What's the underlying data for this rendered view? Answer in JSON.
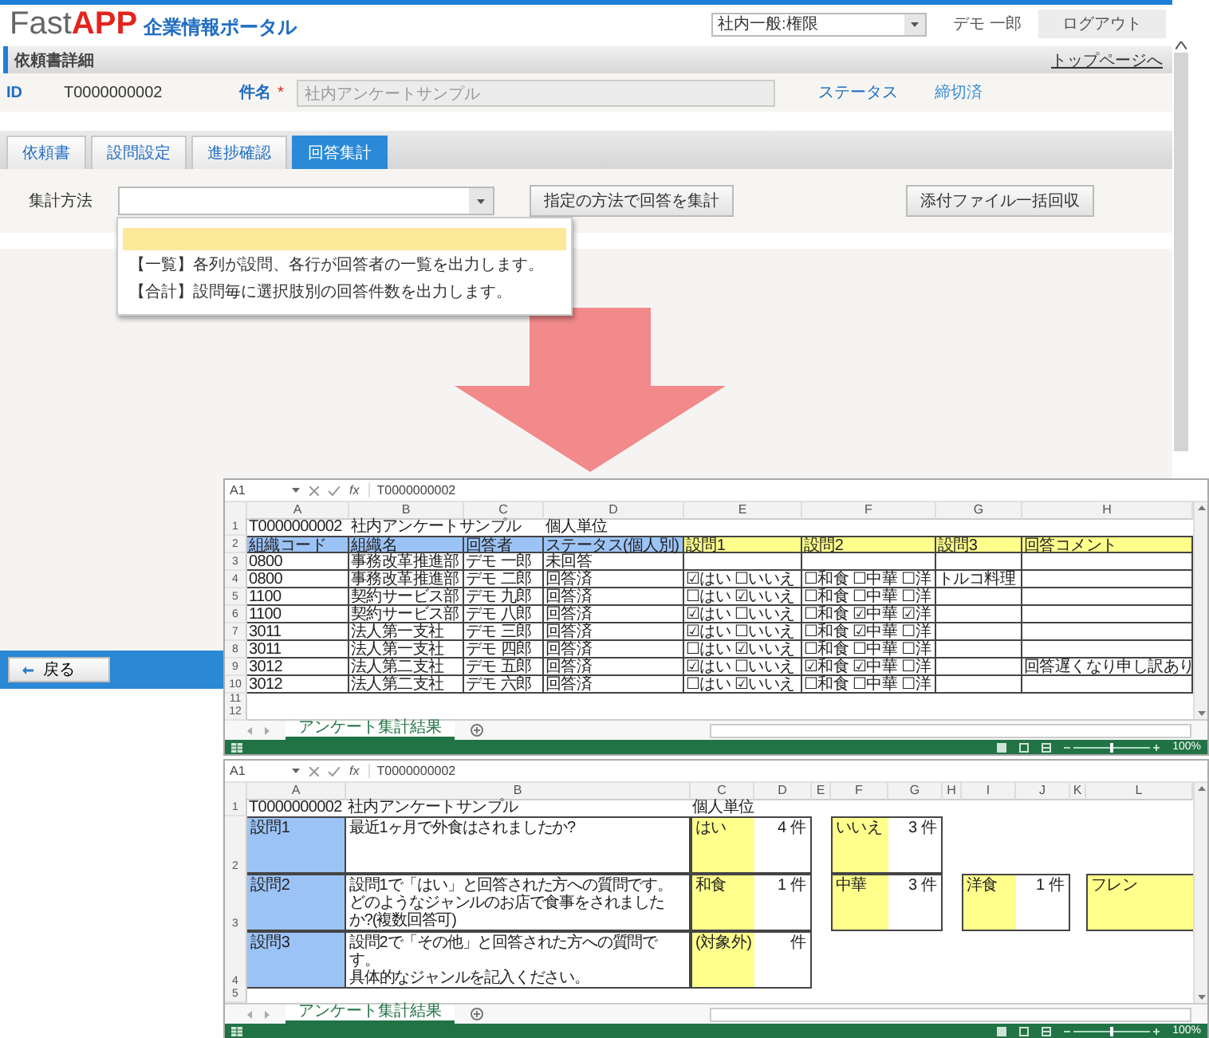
{
  "app": {
    "logo": {
      "brand_a": "Fast",
      "brand_b": "APP",
      "subtitle": "企業情報ポータル"
    },
    "role_select": {
      "value": "社内一般:権限"
    },
    "user_name": "デモ 一郎",
    "logout_button": "ログアウト",
    "section_title": "依頼書詳細",
    "top_page_link": "トップページへ",
    "id_label": "ID",
    "id_value": "T0000000002",
    "subject_label": "件名",
    "required_mark": "*",
    "subject_value": "社内アンケートサンプル",
    "status_label": "ステータス",
    "status_value": "締切済",
    "tabs": [
      {
        "label": "依頼書",
        "selected": false
      },
      {
        "label": "設問設定",
        "selected": false
      },
      {
        "label": "進捗確認",
        "selected": false
      },
      {
        "label": "回答集計",
        "selected": true
      }
    ],
    "method_label": "集計方法",
    "method_options": [
      {
        "kind": "blank",
        "selected": true
      },
      {
        "kind": "text",
        "text": "【一覧】各列が設問、各行が回答者の一覧を出力します。",
        "selected": false
      },
      {
        "kind": "text",
        "text": "【合計】設問毎に選択肢別の回答件数を出力します。",
        "selected": false
      }
    ],
    "buttons": [
      "指定の方法で回答を集計",
      "添付ファイル一括回収"
    ],
    "back_button": "戻る"
  },
  "sheets": [
    {
      "kind": "list",
      "name_box": "A1",
      "function_label": "fx",
      "formula": "T0000000002",
      "columns": [
        "A",
        "B",
        "C",
        "D",
        "E",
        "F",
        "G",
        "H"
      ],
      "rows": [
        {
          "number": "1",
          "kind": "title",
          "cells": [
            "T0000000002",
            "社内アンケートサンプル",
            null,
            "個人単位"
          ]
        },
        {
          "number": "2",
          "kind": "header",
          "cells": [
            {
              "text": "組織コード",
              "color": "#9cc3f5"
            },
            {
              "text": "組織名",
              "color": "#9cc3f5"
            },
            {
              "text": "回答者",
              "color": "#9cc3f5"
            },
            {
              "text": "ステータス(個人別)",
              "color": "#9cc3f5"
            },
            {
              "text": "設問1",
              "color": "#ffff8c"
            },
            {
              "text": "設問2",
              "color": "#ffff8c"
            },
            {
              "text": "設問3",
              "color": "#ffff8c"
            },
            {
              "text": "回答コメント",
              "color": "#ffff8c"
            }
          ]
        },
        {
          "number": "3",
          "kind": "data",
          "cells": [
            "0800",
            "事務改革推進部",
            "デモ 一郎",
            "未回答"
          ]
        },
        {
          "number": "4",
          "kind": "data",
          "cells": [
            "0800",
            "事務改革推進部",
            "デモ 二郎",
            "回答済",
            "☑はい ☐いいえ",
            "☐和食 ☐中華 ☐洋",
            "トルコ料理"
          ]
        },
        {
          "number": "5",
          "kind": "data",
          "cells": [
            "1100",
            "契約サービス部",
            "デモ 九郎",
            "回答済",
            "☐はい ☑いいえ",
            "☐和食 ☐中華 ☐洋"
          ]
        },
        {
          "number": "6",
          "kind": "data",
          "cells": [
            "1100",
            "契約サービス部",
            "デモ 八郎",
            "回答済",
            "☑はい ☐いいえ",
            "☐和食 ☑中華 ☑洋"
          ]
        },
        {
          "number": "7",
          "kind": "data",
          "cells": [
            "3011",
            "法人第一支社",
            "デモ 三郎",
            "回答済",
            "☑はい ☐いいえ",
            "☐和食 ☑中華 ☐洋"
          ]
        },
        {
          "number": "8",
          "kind": "data",
          "cells": [
            "3011",
            "法人第一支社",
            "デモ 四郎",
            "回答済",
            "☐はい ☑いいえ",
            "☐和食 ☐中華 ☐洋"
          ]
        },
        {
          "number": "9",
          "kind": "data",
          "cells": [
            "3012",
            "法人第二支社",
            "デモ 五郎",
            "回答済",
            "☑はい ☐いいえ",
            "☑和食 ☑中華 ☐洋",
            null,
            "回答遅くなり申し訳あり"
          ]
        },
        {
          "number": "10",
          "kind": "data",
          "cells": [
            "3012",
            "法人第二支社",
            "デモ 六郎",
            "回答済",
            "☐はい ☑いいえ",
            "☐和食 ☐中華 ☐洋"
          ]
        }
      ],
      "empty_rows": [
        "11",
        "12"
      ],
      "sheet_tab": "アンケート集計結果",
      "zoom_slider": {
        "level": 0.5
      },
      "zoom": "100%"
    },
    {
      "kind": "summary",
      "name_box": "A1",
      "function_label": "fx",
      "formula": "T0000000002",
      "columns": [
        "A",
        "B",
        "C",
        "D",
        "E",
        "F",
        "G",
        "H",
        "I",
        "J",
        "K",
        "L"
      ],
      "title_row": {
        "number": "1",
        "cells": [
          "T0000000002",
          "社内アンケートサンプル",
          "個人単位"
        ]
      },
      "questions": [
        {
          "number": "2",
          "label": "設問1",
          "lines": [
            "最近1ヶ月で外食はされましたか?"
          ],
          "answers": [
            {
              "label": "はい",
              "count": "4 件"
            },
            {
              "label": "いいえ",
              "count": "3 件"
            }
          ]
        },
        {
          "number": "3",
          "label": "設問2",
          "lines": [
            "設問1で「はい」と回答された方への質問です。",
            "どのようなジャンルのお店で食事をされましたか?(複数回答可)"
          ],
          "answers": [
            {
              "label": "和食",
              "count": "1 件"
            },
            {
              "label": "中華",
              "count": "3 件"
            },
            {
              "label": "洋食",
              "count": "1 件"
            },
            {
              "label": "フレン"
            }
          ]
        },
        {
          "number": "4",
          "label": "設問3",
          "lines": [
            "設問2で「その他」と回答された方への質問です。",
            "具体的なジャンルを記入ください。"
          ],
          "answers": [
            {
              "label": "(対象外)",
              "count": "件"
            }
          ]
        }
      ],
      "empty_rows": [
        "5"
      ],
      "sheet_tab": "アンケート集計結果",
      "zoom_slider": {
        "level": 0.5
      },
      "zoom": "100%"
    }
  ]
}
